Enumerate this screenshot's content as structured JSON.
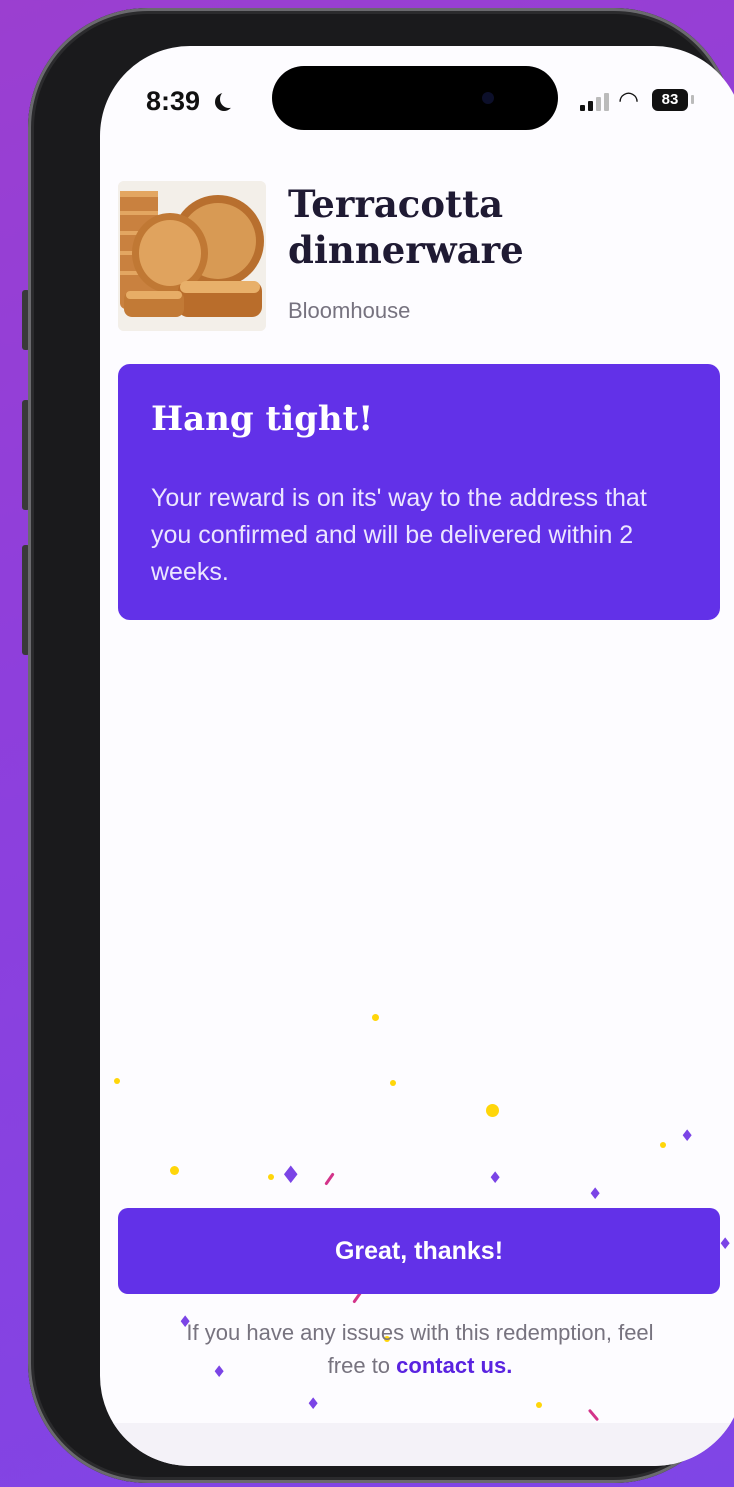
{
  "status_bar": {
    "time": "8:39",
    "battery": "83",
    "icons": [
      "moon-icon",
      "signal-icon",
      "wifi-icon",
      "battery-icon"
    ]
  },
  "product": {
    "title": "Terracotta dinnerware",
    "brand": "Bloomhouse",
    "image": "terracotta-dinnerware-image"
  },
  "message_card": {
    "title": "Hang tight!",
    "body": "Your reward is on its' way to the address that you confirmed and will be delivered within 2 weeks.",
    "color": "#6231E8"
  },
  "cta": {
    "label": "Great, thanks!"
  },
  "footer": {
    "text": "If you have any issues with this redemption, feel free to",
    "link": "contact us."
  },
  "colors": {
    "accent": "#6231E8",
    "background": "#8E3FDC",
    "confetti_yellow": "#FFD60A",
    "confetti_gem": "#7B44E6",
    "confetti_streak": "#D3338A"
  }
}
